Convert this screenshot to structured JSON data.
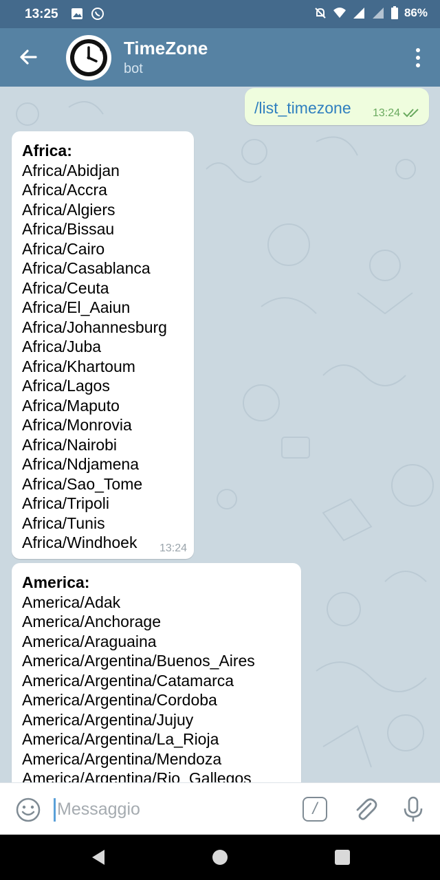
{
  "status_bar": {
    "time": "13:25",
    "battery": "86%"
  },
  "header": {
    "title": "TimeZone",
    "subtitle": "bot"
  },
  "chat": {
    "outgoing": {
      "text": "/list_timezone",
      "time": "13:24",
      "status": "read"
    },
    "incoming": [
      {
        "heading": "Africa:",
        "time": "13:24",
        "lines": [
          "Africa/Abidjan",
          "Africa/Accra",
          "Africa/Algiers",
          "Africa/Bissau",
          "Africa/Cairo",
          "Africa/Casablanca",
          "Africa/Ceuta",
          "Africa/El_Aaiun",
          "Africa/Johannesburg",
          "Africa/Juba",
          "Africa/Khartoum",
          "Africa/Lagos",
          "Africa/Maputo",
          "Africa/Monrovia",
          "Africa/Nairobi",
          "Africa/Ndjamena",
          "Africa/Sao_Tome",
          "Africa/Tripoli",
          "Africa/Tunis",
          "Africa/Windhoek"
        ]
      },
      {
        "heading": "America:",
        "lines": [
          "America/Adak",
          "America/Anchorage",
          "America/Araguaina",
          "America/Argentina/Buenos_Aires",
          "America/Argentina/Catamarca",
          "America/Argentina/Cordoba",
          "America/Argentina/Jujuy",
          "America/Argentina/La_Rioja",
          "America/Argentina/Mendoza",
          "America/Argentina/Rio_Gallegos"
        ]
      }
    ]
  },
  "input_bar": {
    "placeholder": "Messaggio",
    "command_label": "/"
  },
  "colors": {
    "status_bar": "#446a8c",
    "header": "#5682a3",
    "chat_background": "#cbd8e0",
    "outgoing_bubble": "#effdde",
    "incoming_bubble": "#ffffff",
    "link_text": "#2f7fbf"
  }
}
